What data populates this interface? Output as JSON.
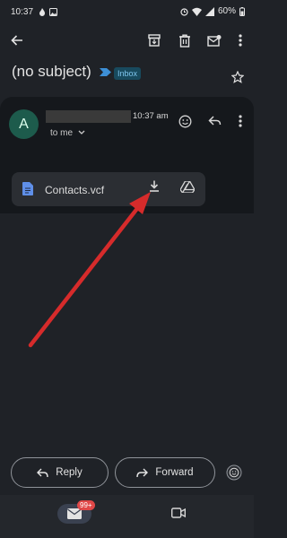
{
  "status_bar": {
    "time": "10:37",
    "battery": "60%"
  },
  "toolbar": {
    "back_icon": "arrow-left-icon",
    "archive_icon": "archive-icon",
    "delete_icon": "trash-icon",
    "mark_unread_icon": "mail-unread-icon",
    "more_icon": "more-vert-icon"
  },
  "email": {
    "subject": "(no subject)",
    "label": "Inbox",
    "time": "10:37 am",
    "recipient_line": "to me",
    "avatar_letter": "A"
  },
  "attachment": {
    "file_name": "Contacts.vcf"
  },
  "actions": {
    "reply_label": "Reply",
    "forward_label": "Forward"
  },
  "bottom_nav": {
    "mail_badge": "99+"
  },
  "colors": {
    "background": "#1f2227",
    "card": "#15181c",
    "annotation_arrow": "#d62b2b",
    "avatar": "#1d5b4c",
    "label_text": "#7fc6ef"
  }
}
